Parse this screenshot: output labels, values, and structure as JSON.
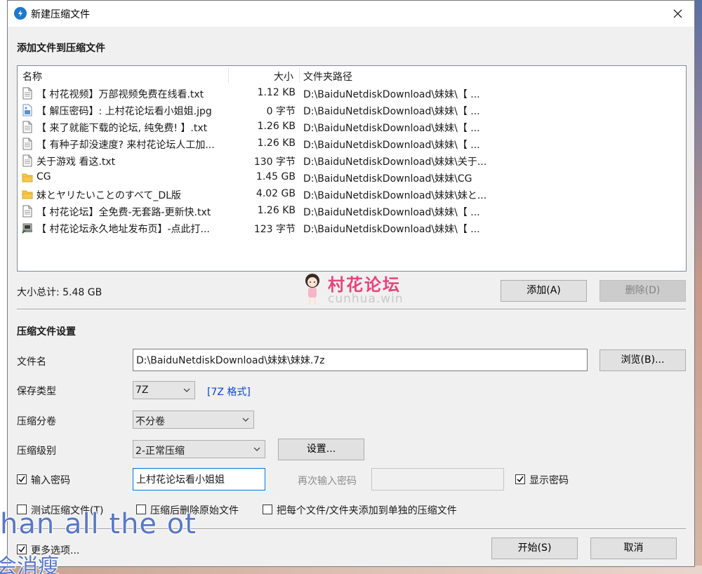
{
  "window": {
    "title": "新建压缩文件"
  },
  "add_section": {
    "title": "添加文件到压缩文件"
  },
  "file_list": {
    "columns": [
      "名称",
      "大小",
      "文件夹路径"
    ],
    "rows": [
      {
        "icon": "text-file-icon",
        "name": "【 村花视频】万部视频免费在线看.txt",
        "size": "1.12 KB",
        "path": "D:\\BaiduNetdiskDownload\\妹妹\\【 ..."
      },
      {
        "icon": "image-file-icon",
        "name": "【 解压密码】: 上村花论坛看小姐姐.jpg",
        "size": "0 字节",
        "path": "D:\\BaiduNetdiskDownload\\妹妹\\【 ..."
      },
      {
        "icon": "text-file-icon",
        "name": "【 来了就能下载的论坛, 纯免费! 】.txt",
        "size": "1.26 KB",
        "path": "D:\\BaiduNetdiskDownload\\妹妹\\【 ..."
      },
      {
        "icon": "text-file-icon",
        "name": "【 有种子却没速度? 来村花论坛人工加...",
        "size": "1.26 KB",
        "path": "D:\\BaiduNetdiskDownload\\妹妹\\【 ..."
      },
      {
        "icon": "text-file-icon",
        "name": "关于游戏 看这.txt",
        "size": "130 字节",
        "path": "D:\\BaiduNetdiskDownload\\妹妹\\关于..."
      },
      {
        "icon": "folder-icon",
        "name": "CG",
        "size": "1.45 GB",
        "path": "D:\\BaiduNetdiskDownload\\妹妹\\CG"
      },
      {
        "icon": "folder-icon",
        "name": "妹とヤリたいことのすべて_DL版",
        "size": "4.02 GB",
        "path": "D:\\BaiduNetdiskDownload\\妹妹\\妹と..."
      },
      {
        "icon": "text-file-icon",
        "name": "【 村花论坛】全免费-无套路-更新快.txt",
        "size": "1.26 KB",
        "path": "D:\\BaiduNetdiskDownload\\妹妹\\【 ..."
      },
      {
        "icon": "url-shortcut-icon",
        "name": "【 村花论坛永久地址发布页】-点此打...",
        "size": "123 字节",
        "path": "D:\\BaiduNetdiskDownload\\妹妹\\【 ..."
      }
    ]
  },
  "total_size": "大小总计: 5.48 GB",
  "buttons": {
    "add": "添加(A)",
    "delete": "删除(D)",
    "browse": "浏览(B)...",
    "settings": "设置...",
    "start": "开始(S)",
    "cancel": "取消"
  },
  "settings_section": {
    "title": "压缩文件设置"
  },
  "fields": {
    "filename_label": "文件名",
    "filename_value": "D:\\BaiduNetdiskDownload\\妹妹\\妹妹.7z",
    "type_label": "保存类型",
    "type_value": "7Z",
    "type_link": "[7Z 格式]",
    "split_label": "压缩分卷",
    "split_value": "不分卷",
    "level_label": "压缩级别",
    "level_value": "2-正常压缩",
    "password_label": "输入密码",
    "password_value": "上村花论坛看小姐姐",
    "reenter_label": "再次输入密码",
    "show_password_label": "显示密码"
  },
  "checkboxes": {
    "password": {
      "label": "输入密码",
      "checked": true
    },
    "show_password": {
      "label": "显示密码",
      "checked": true
    },
    "test": {
      "label": "测试压缩文件(T)",
      "checked": false
    },
    "delete_after": {
      "label": "压缩后删除原始文件",
      "checked": false
    },
    "separate": {
      "label": "把每个文件/文件夹添加到单独的压缩文件",
      "checked": false
    },
    "more_options": {
      "label": "更多选项...",
      "checked": true
    }
  },
  "watermark": {
    "title": "村花论坛",
    "subtitle": "cunhua.win"
  },
  "overlay_subtitles": {
    "english": "han all the ot",
    "chinese": "会消瘦"
  }
}
